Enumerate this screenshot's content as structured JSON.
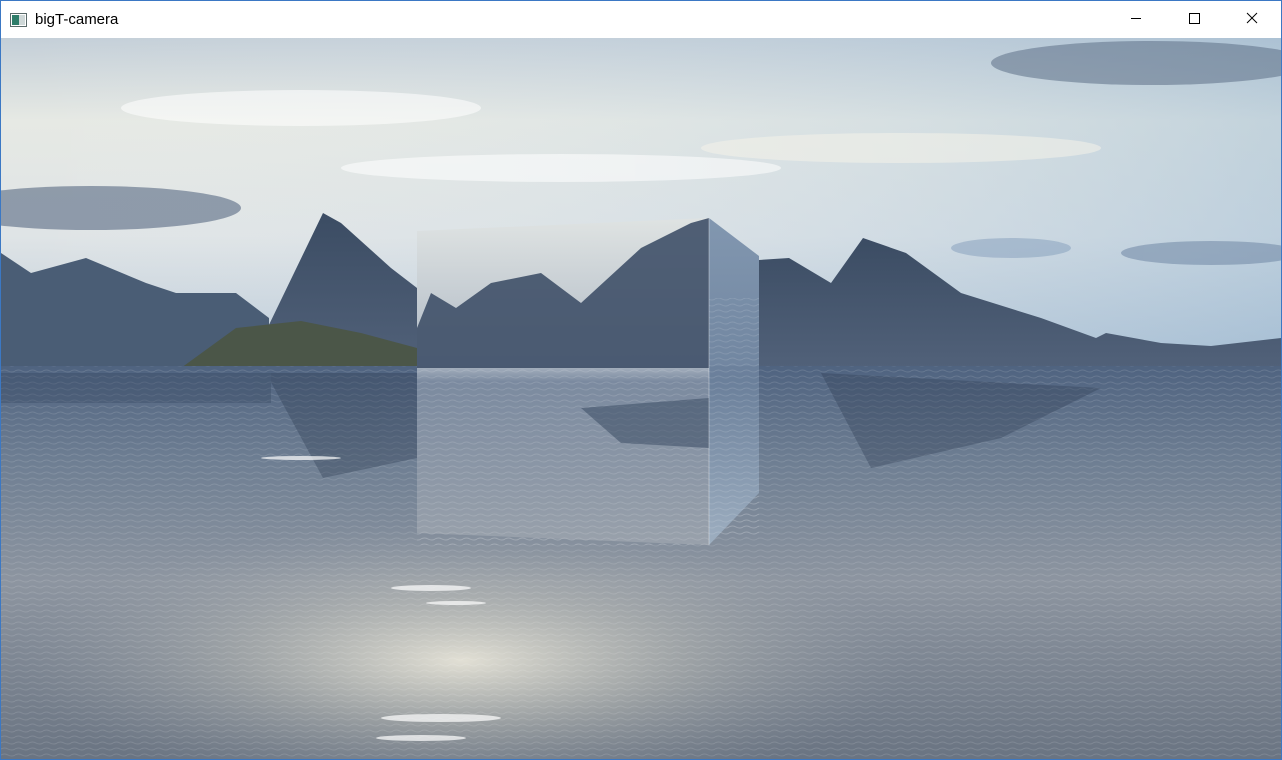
{
  "window": {
    "title": "bigT-camera",
    "icon": "app-window-icon",
    "controls": {
      "minimize_icon": "minimize-icon",
      "maximize_icon": "maximize-icon",
      "close_icon": "close-icon"
    },
    "border_color": "#3b78c4"
  },
  "scene": {
    "description_icons": [
      "skybox",
      "mountains",
      "water",
      "reflective-cube"
    ],
    "colors": {
      "sky_top": "#c9d4dc",
      "sky_mid": "#e9ebe2",
      "mountain": "#3d5068",
      "water_near": "#8a93a0",
      "water_far": "#5e7089",
      "sun_glint": "#f2efe0"
    }
  }
}
